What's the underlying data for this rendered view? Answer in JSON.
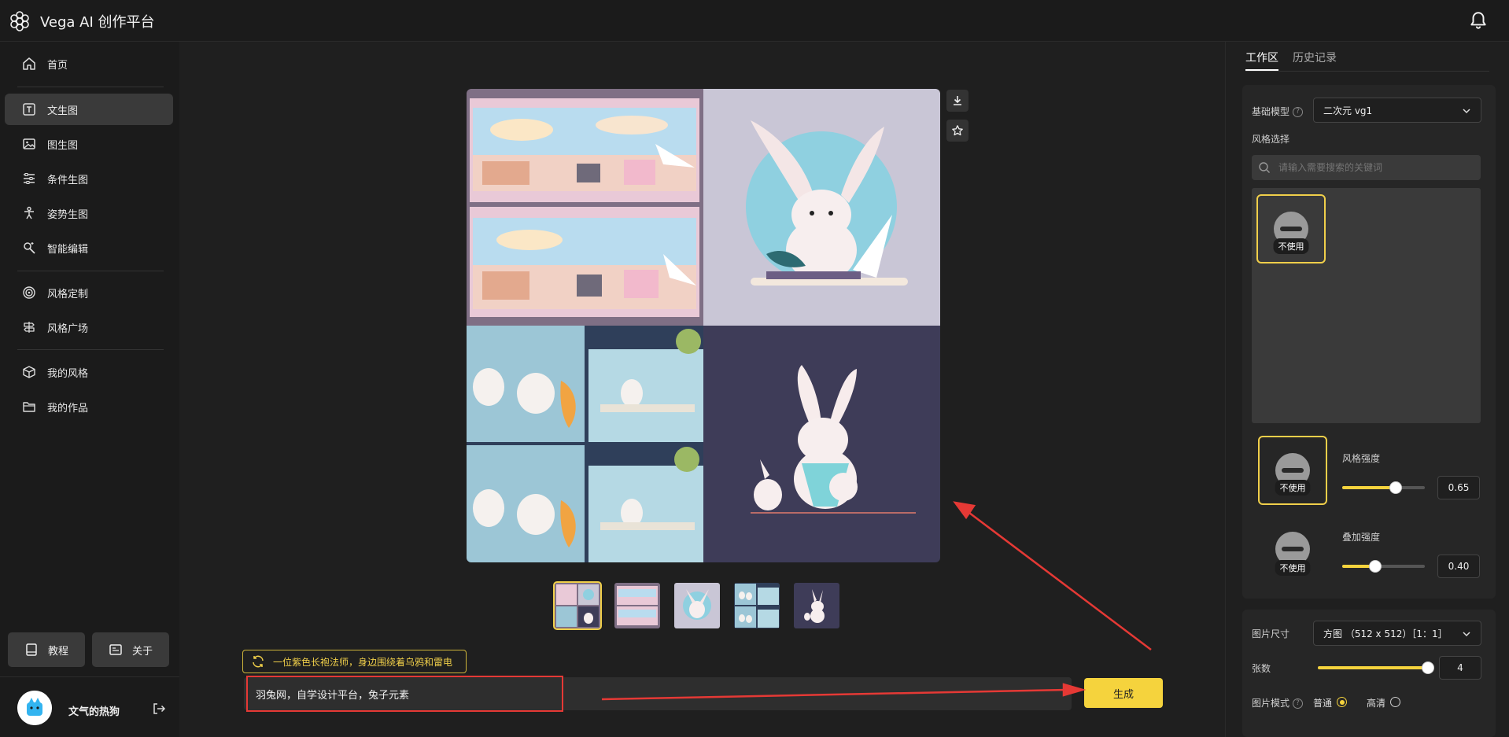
{
  "app": {
    "title": "Vega AI 创作平台"
  },
  "sidebar": {
    "items": [
      {
        "label": "首页",
        "icon": "home-icon"
      },
      {
        "label": "文生图",
        "icon": "text-image-icon",
        "active": true
      },
      {
        "label": "图生图",
        "icon": "image-icon"
      },
      {
        "label": "条件生图",
        "icon": "sliders-icon"
      },
      {
        "label": "姿势生图",
        "icon": "pose-icon"
      },
      {
        "label": "智能编辑",
        "icon": "magic-edit-icon"
      },
      {
        "label": "风格定制",
        "icon": "target-icon"
      },
      {
        "label": "风格广场",
        "icon": "signpost-icon"
      },
      {
        "label": "我的风格",
        "icon": "cube-icon"
      },
      {
        "label": "我的作品",
        "icon": "folder-icon"
      }
    ],
    "tutorial_label": "教程",
    "about_label": "关于",
    "user_name": "文气的热狗"
  },
  "main": {
    "suggestion": "一位紫色长袍法师，身边围绕着乌鸦和雷电",
    "prompt_value": "羽兔网，自学设计平台，兔子元素",
    "generate_label": "生成",
    "selected_thumbnail": 1
  },
  "panel": {
    "tabs": [
      "工作区",
      "历史记录"
    ],
    "base_model_label": "基础模型",
    "base_model_value": "二次元 vg1",
    "style_select_label": "风格选择",
    "search_placeholder": "请输入需要搜索的关键词",
    "no_use_label": "不使用",
    "style_strength_label": "风格强度",
    "style_strength_value": "0.65",
    "style_strength": 0.65,
    "overlay_strength_label": "叠加强度",
    "overlay_strength_value": "0.40",
    "overlay_strength": 0.4,
    "image_size_label": "图片尺寸",
    "image_size_value": "方图 （512 x 512）［1：1］",
    "count_label": "张数",
    "count_value": "4",
    "count_fraction": 1.0,
    "mode_label": "图片模式",
    "mode_normal": "普通",
    "mode_hd": "高清",
    "mode_selected": "普通"
  },
  "colors": {
    "accent": "#f5d33d",
    "annotation": "#e53935",
    "background": "#1f1f1f"
  }
}
